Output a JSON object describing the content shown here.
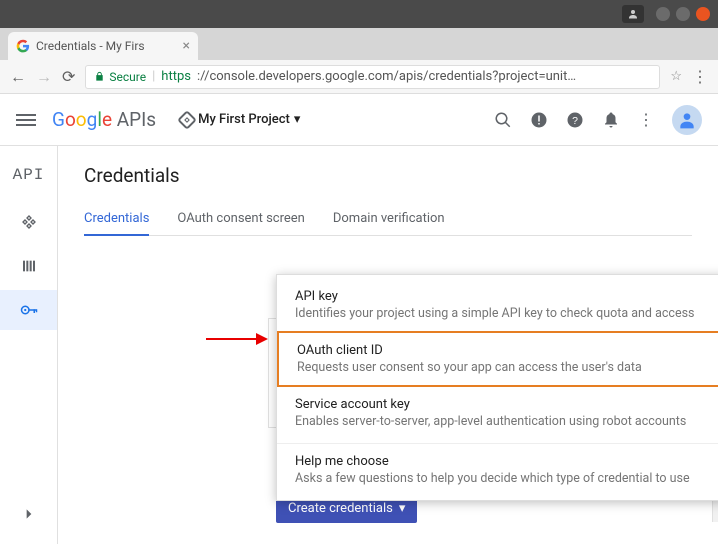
{
  "browser": {
    "tab_title": "Credentials - My Firs",
    "secure_label": "Secure",
    "url_https": "https",
    "url_rest": "://console.developers.google.com/apis/credentials?project=unit…"
  },
  "header": {
    "logo_apis": " APIs",
    "project_name": "My First Project"
  },
  "sidebar": {
    "title": "API"
  },
  "page": {
    "title": "Credentials",
    "tabs": [
      "Credentials",
      "OAuth consent screen",
      "Domain verification"
    ]
  },
  "menu": {
    "items": [
      {
        "title": "API key",
        "desc": "Identifies your project using a simple API key to check quota and access"
      },
      {
        "title": "OAuth client ID",
        "desc": "Requests user consent so your app can access the user's data"
      },
      {
        "title": "Service account key",
        "desc": "Enables server-to-server, app-level authentication using robot accounts"
      },
      {
        "title": "Help me choose",
        "desc": "Asks a few questions to help you decide which type of credential to use"
      }
    ]
  },
  "create_button": "Create credentials"
}
